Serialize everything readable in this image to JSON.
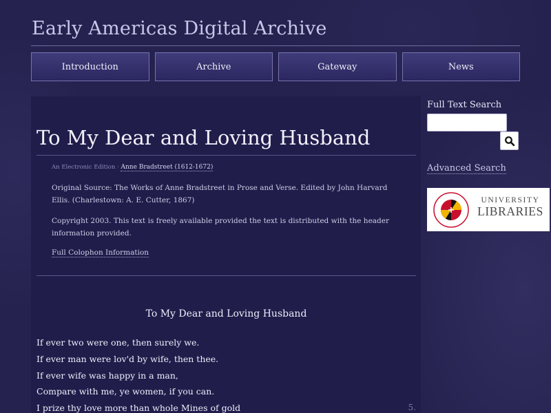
{
  "header": {
    "site_title": "Early Americas Digital Archive"
  },
  "nav": {
    "items": [
      {
        "label": "Introduction"
      },
      {
        "label": "Archive"
      },
      {
        "label": "Gateway"
      },
      {
        "label": "News"
      }
    ]
  },
  "document": {
    "title": "To My Dear and Loving Husband",
    "edition_label": "An Electronic Edition",
    "separator": "·",
    "author": "Anne Bradstreet (1612-1672)",
    "source": "Original Source: The Works of Anne Bradstreet in Prose and Verse. Edited by John Harvard Ellis. (Charlestown: A. E. Cutter, 1867)",
    "copyright": "Copyright 2003. This text is freely available provided the text is distributed with the header information provided.",
    "colophon_link": "Full Colophon Information"
  },
  "poem": {
    "title": "To My Dear and Loving Husband",
    "lines": [
      "If ever two were one, then surely we.",
      "If ever man were lov'd by wife, then thee.",
      "If ever wife was happy in a man,",
      "Compare with me, ye women, if you can.",
      "I prize thy love more than whole Mines of gold"
    ],
    "line_number_5": "5."
  },
  "sidebar": {
    "search_label": "Full Text Search",
    "search_placeholder": "",
    "advanced_link": "Advanced Search",
    "logo": {
      "seal_text": "UNIVERSITY OF MARYLAND",
      "line1": "UNIVERSITY",
      "line2": "LIBRARIES"
    }
  },
  "colors": {
    "background": "#23204f",
    "nav_button": "#34316d",
    "maryland_red": "#c8102e",
    "maryland_gold": "#f2b400"
  },
  "icons": {
    "search_button": "search-icon"
  }
}
